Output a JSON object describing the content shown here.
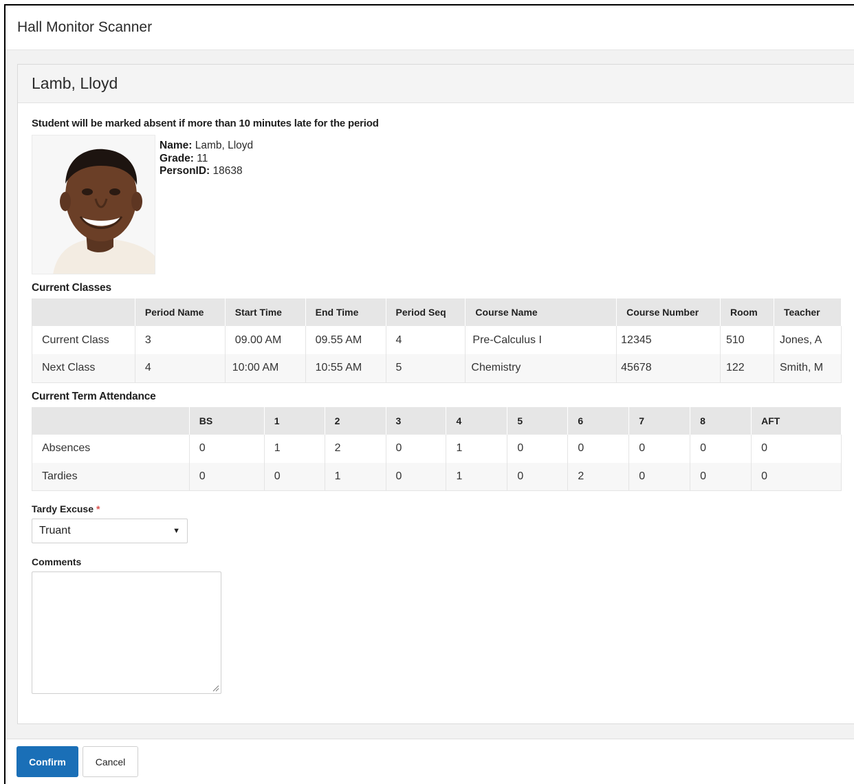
{
  "app": {
    "title": "Hall Monitor Scanner"
  },
  "student": {
    "header_name": "Lamb, Lloyd",
    "notice": "Student will be marked absent if more than 10 minutes late for the period",
    "name_label": "Name:",
    "name": "Lamb, Lloyd",
    "grade_label": "Grade:",
    "grade": "11",
    "personid_label": "PersonID:",
    "personid": "18638"
  },
  "classes": {
    "title": "Current Classes",
    "headers": [
      "",
      "Period Name",
      "Start Time",
      "End Time",
      "Period Seq",
      "Course Name",
      "Course Number",
      "Room",
      "Teacher"
    ],
    "rows": [
      [
        "Current Class",
        "3",
        "09.00 AM",
        "09.55 AM",
        "4",
        "Pre-Calculus I",
        "12345",
        "510",
        "Jones, A"
      ],
      [
        "Next Class",
        "4",
        "10:00 AM",
        "10:55 AM",
        "5",
        "Chemistry",
        "45678",
        "122",
        "Smith, M"
      ]
    ]
  },
  "attendance": {
    "title": "Current Term Attendance",
    "headers": [
      "",
      "BS",
      "1",
      "2",
      "3",
      "4",
      "5",
      "6",
      "7",
      "8",
      "AFT"
    ],
    "rows": [
      [
        "Absences",
        "0",
        "1",
        "2",
        "0",
        "1",
        "0",
        "0",
        "0",
        "0",
        "0"
      ],
      [
        "Tardies",
        "0",
        "0",
        "1",
        "0",
        "1",
        "0",
        "2",
        "0",
        "0",
        "0"
      ]
    ]
  },
  "form": {
    "tardy_label": "Tardy Excuse",
    "required_mark": "*",
    "tardy_value": "Truant",
    "comments_label": "Comments",
    "comments_value": ""
  },
  "footer": {
    "confirm_label": "Confirm",
    "cancel_label": "Cancel"
  }
}
